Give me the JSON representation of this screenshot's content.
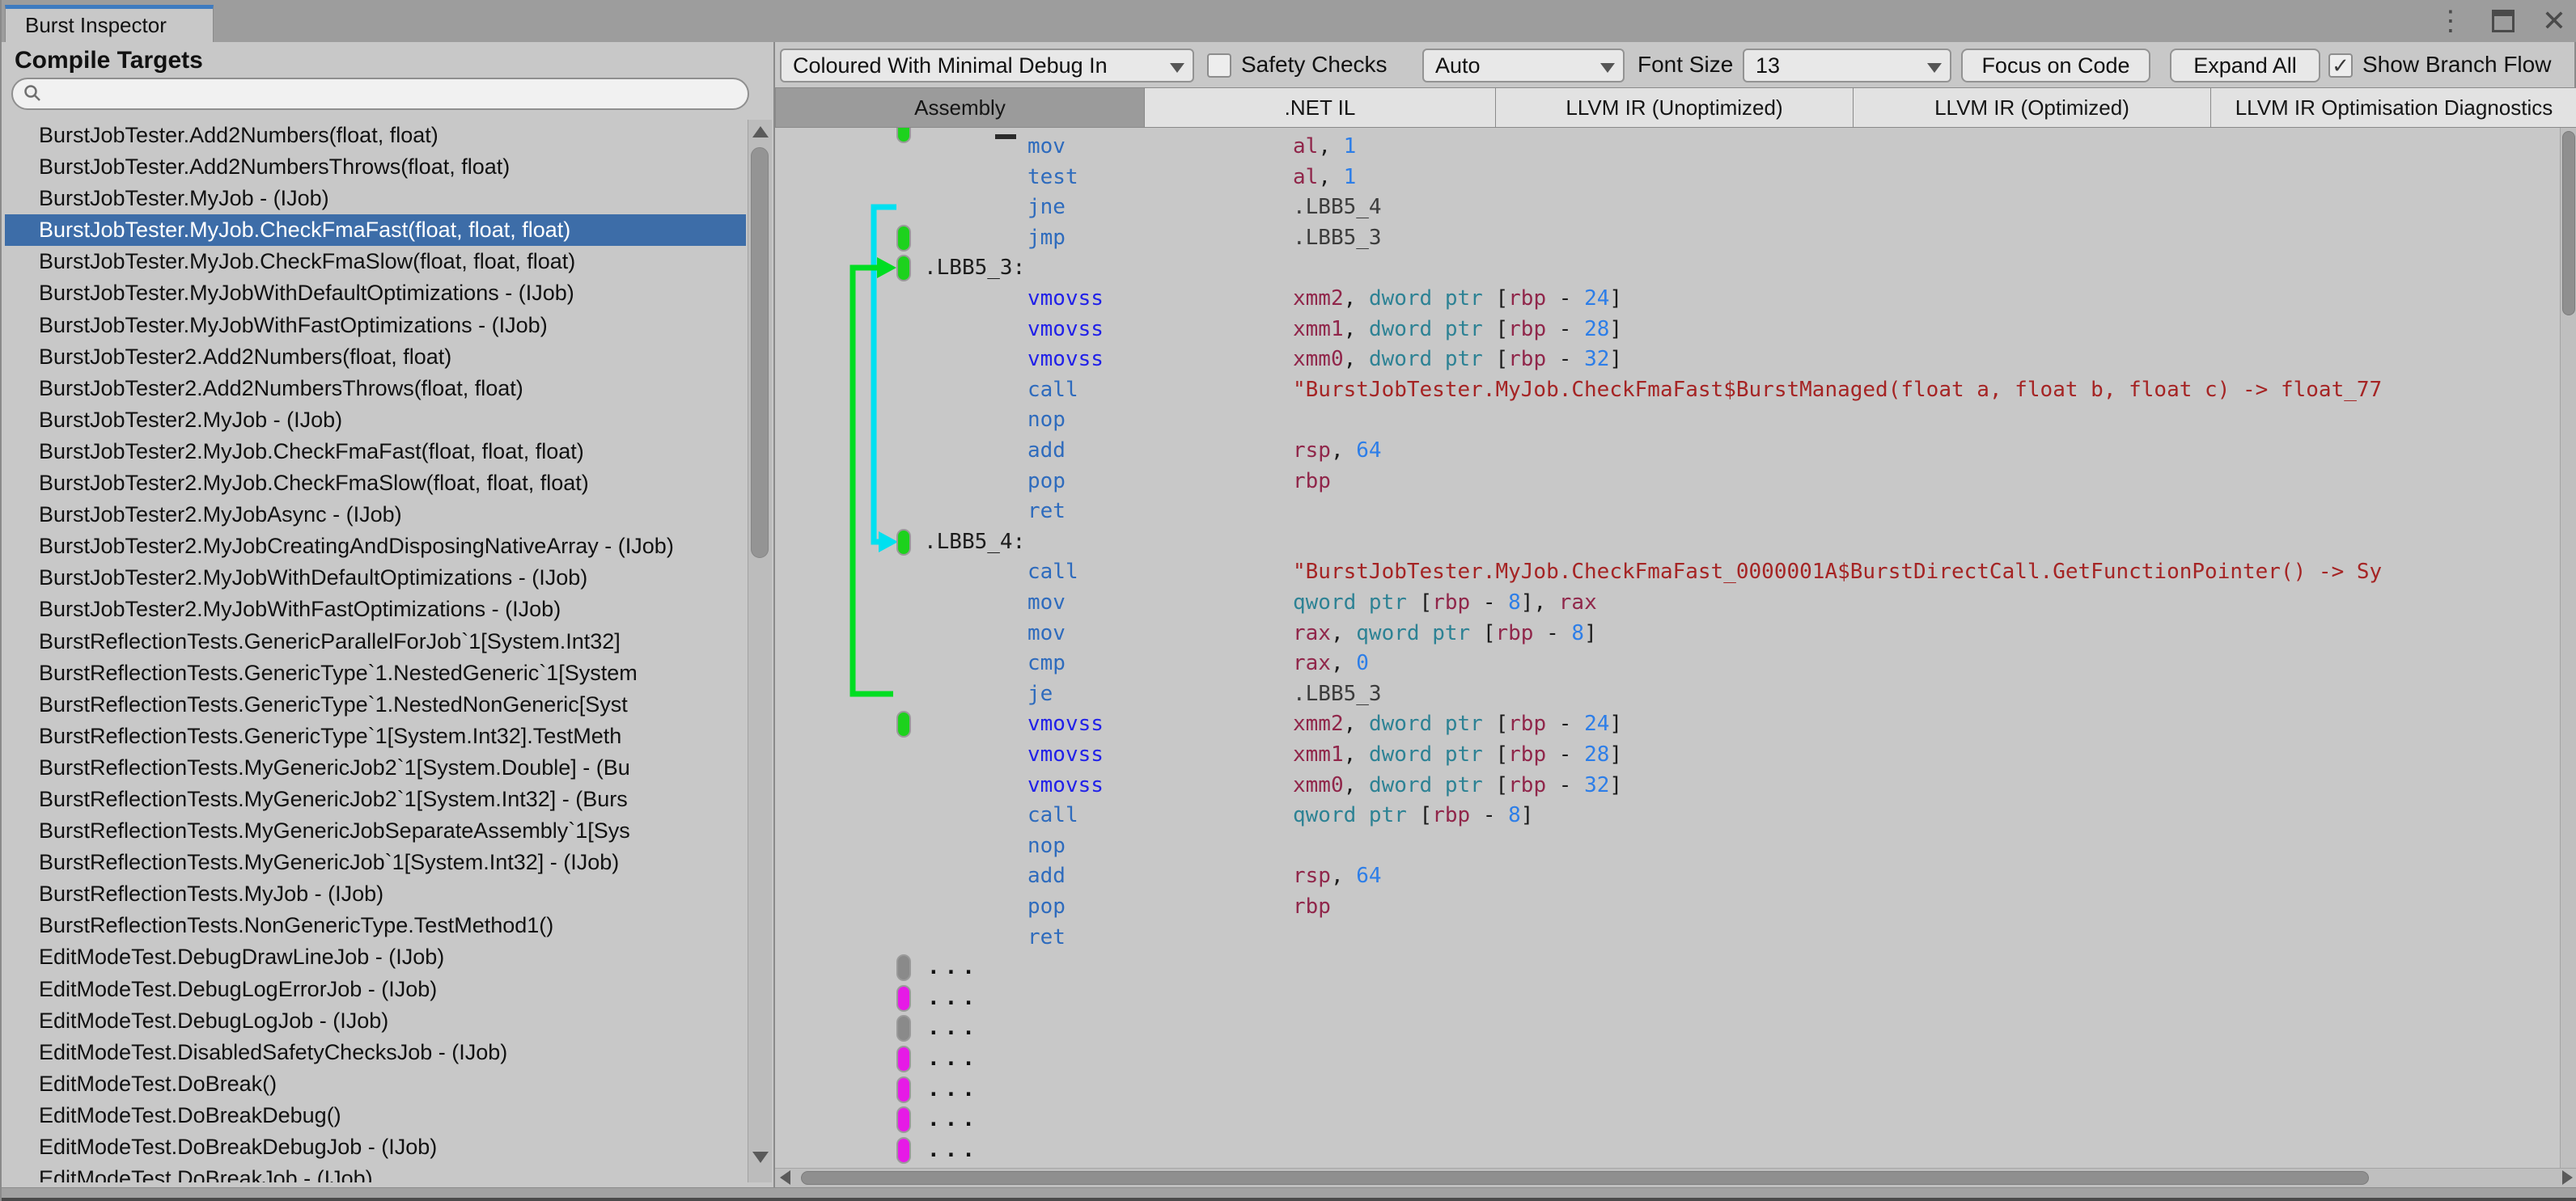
{
  "window": {
    "title_tab": "Burst Inspector",
    "controls": {
      "menu": "⋮",
      "close": "✕"
    }
  },
  "left_panel": {
    "header": "Compile Targets",
    "search_placeholder": "",
    "items": [
      {
        "label": "BurstJobTester.Add2Numbers(float, float)",
        "selected": false
      },
      {
        "label": "BurstJobTester.Add2NumbersThrows(float, float)",
        "selected": false
      },
      {
        "label": "BurstJobTester.MyJob - (IJob)",
        "selected": false
      },
      {
        "label": "BurstJobTester.MyJob.CheckFmaFast(float, float, float)",
        "selected": true
      },
      {
        "label": "BurstJobTester.MyJob.CheckFmaSlow(float, float, float)",
        "selected": false
      },
      {
        "label": "BurstJobTester.MyJobWithDefaultOptimizations - (IJob)",
        "selected": false
      },
      {
        "label": "BurstJobTester.MyJobWithFastOptimizations - (IJob)",
        "selected": false
      },
      {
        "label": "BurstJobTester2.Add2Numbers(float, float)",
        "selected": false
      },
      {
        "label": "BurstJobTester2.Add2NumbersThrows(float, float)",
        "selected": false
      },
      {
        "label": "BurstJobTester2.MyJob - (IJob)",
        "selected": false
      },
      {
        "label": "BurstJobTester2.MyJob.CheckFmaFast(float, float, float)",
        "selected": false
      },
      {
        "label": "BurstJobTester2.MyJob.CheckFmaSlow(float, float, float)",
        "selected": false
      },
      {
        "label": "BurstJobTester2.MyJobAsync - (IJob)",
        "selected": false
      },
      {
        "label": "BurstJobTester2.MyJobCreatingAndDisposingNativeArray - (IJob)",
        "selected": false
      },
      {
        "label": "BurstJobTester2.MyJobWithDefaultOptimizations - (IJob)",
        "selected": false
      },
      {
        "label": "BurstJobTester2.MyJobWithFastOptimizations - (IJob)",
        "selected": false
      },
      {
        "label": "BurstReflectionTests.GenericParallelForJob`1[System.Int32]",
        "selected": false
      },
      {
        "label": "BurstReflectionTests.GenericType`1.NestedGeneric`1[System",
        "selected": false
      },
      {
        "label": "BurstReflectionTests.GenericType`1.NestedNonGeneric[Syst",
        "selected": false
      },
      {
        "label": "BurstReflectionTests.GenericType`1[System.Int32].TestMeth",
        "selected": false
      },
      {
        "label": "BurstReflectionTests.MyGenericJob2`1[System.Double] - (Bu",
        "selected": false
      },
      {
        "label": "BurstReflectionTests.MyGenericJob2`1[System.Int32] - (Burs",
        "selected": false
      },
      {
        "label": "BurstReflectionTests.MyGenericJobSeparateAssembly`1[Sys",
        "selected": false
      },
      {
        "label": "BurstReflectionTests.MyGenericJob`1[System.Int32] - (IJob)",
        "selected": false
      },
      {
        "label": "BurstReflectionTests.MyJob - (IJob)",
        "selected": false
      },
      {
        "label": "BurstReflectionTests.NonGenericType.TestMethod1()",
        "selected": false
      },
      {
        "label": "EditModeTest.DebugDrawLineJob - (IJob)",
        "selected": false
      },
      {
        "label": "EditModeTest.DebugLogErrorJob - (IJob)",
        "selected": false
      },
      {
        "label": "EditModeTest.DebugLogJob - (IJob)",
        "selected": false
      },
      {
        "label": "EditModeTest.DisabledSafetyChecksJob - (IJob)",
        "selected": false
      },
      {
        "label": "EditModeTest.DoBreak()",
        "selected": false
      },
      {
        "label": "EditModeTest.DoBreakDebug()",
        "selected": false
      },
      {
        "label": "EditModeTest.DoBreakDebugJob - (IJob)",
        "selected": false
      },
      {
        "label": "EditModeTest.DoBreakJob - (IJob)",
        "selected": false
      }
    ]
  },
  "toolbar": {
    "display_mode": "Coloured With Minimal Debug In",
    "safety_checks_label": "Safety Checks",
    "safety_checks_checked": false,
    "target_dropdown": "Auto",
    "font_size_label": "Font Size",
    "font_size_value": "13",
    "focus_button": "Focus on Code",
    "expand_button": "Expand All",
    "branch_flow_label": "Show Branch Flow",
    "branch_flow_checked": true,
    "checkmark": "✓"
  },
  "tabs": [
    {
      "label": "Assembly",
      "active": true
    },
    {
      "label": ".NET IL",
      "active": false
    },
    {
      "label": "LLVM IR (Unoptimized)",
      "active": false
    },
    {
      "label": "LLVM IR (Optimized)",
      "active": false
    },
    {
      "label": "LLVM IR Optimisation Diagnostics",
      "active": false
    }
  ],
  "code": {
    "lines": [
      {
        "kind": "ins",
        "mn": "mov",
        "mnc": "t-mn",
        "ops": [
          [
            "t-reg",
            "al"
          ],
          [
            "t-pu",
            ", "
          ],
          [
            "t-num",
            "1"
          ]
        ]
      },
      {
        "kind": "ins",
        "mn": "test",
        "mnc": "t-mn",
        "ops": [
          [
            "t-reg",
            "al"
          ],
          [
            "t-pu",
            ", "
          ],
          [
            "t-num",
            "1"
          ]
        ]
      },
      {
        "kind": "ins",
        "mn": "jne",
        "mnc": "t-mn",
        "ops": [
          [
            "t-lbl",
            ".LBB5_4"
          ]
        ]
      },
      {
        "kind": "ins",
        "mn": "jmp",
        "mnc": "t-mn",
        "ops": [
          [
            "t-lbl",
            ".LBB5_3"
          ]
        ],
        "pill": "p-green"
      },
      {
        "kind": "label",
        "label": ".LBB5_3:",
        "pill": "p-green"
      },
      {
        "kind": "ins",
        "mn": "vmovss",
        "mnc": "t-simd",
        "ops": [
          [
            "t-reg",
            "xmm2"
          ],
          [
            "t-pu",
            ", "
          ],
          [
            "t-kw",
            "dword ptr"
          ],
          [
            "t-pu",
            " ["
          ],
          [
            "t-reg",
            "rbp"
          ],
          [
            "t-pu",
            " - "
          ],
          [
            "t-num",
            "24"
          ],
          [
            "t-pu",
            "]"
          ]
        ]
      },
      {
        "kind": "ins",
        "mn": "vmovss",
        "mnc": "t-simd",
        "ops": [
          [
            "t-reg",
            "xmm1"
          ],
          [
            "t-pu",
            ", "
          ],
          [
            "t-kw",
            "dword ptr"
          ],
          [
            "t-pu",
            " ["
          ],
          [
            "t-reg",
            "rbp"
          ],
          [
            "t-pu",
            " - "
          ],
          [
            "t-num",
            "28"
          ],
          [
            "t-pu",
            "]"
          ]
        ]
      },
      {
        "kind": "ins",
        "mn": "vmovss",
        "mnc": "t-simd",
        "ops": [
          [
            "t-reg",
            "xmm0"
          ],
          [
            "t-pu",
            ", "
          ],
          [
            "t-kw",
            "dword ptr"
          ],
          [
            "t-pu",
            " ["
          ],
          [
            "t-reg",
            "rbp"
          ],
          [
            "t-pu",
            " - "
          ],
          [
            "t-num",
            "32"
          ],
          [
            "t-pu",
            "]"
          ]
        ]
      },
      {
        "kind": "ins",
        "mn": "call",
        "mnc": "t-mn",
        "ops": [
          [
            "t-str",
            "\"BurstJobTester.MyJob.CheckFmaFast$BurstManaged(float a, float b, float c) -> float_77"
          ]
        ]
      },
      {
        "kind": "ins",
        "mn": "nop",
        "mnc": "t-mn",
        "ops": []
      },
      {
        "kind": "ins",
        "mn": "add",
        "mnc": "t-mn",
        "ops": [
          [
            "t-reg",
            "rsp"
          ],
          [
            "t-pu",
            ", "
          ],
          [
            "t-num",
            "64"
          ]
        ]
      },
      {
        "kind": "ins",
        "mn": "pop",
        "mnc": "t-mn",
        "ops": [
          [
            "t-reg",
            "rbp"
          ]
        ]
      },
      {
        "kind": "ins",
        "mn": "ret",
        "mnc": "t-mn",
        "ops": []
      },
      {
        "kind": "label",
        "label": ".LBB5_4:",
        "pill": "p-green"
      },
      {
        "kind": "ins",
        "mn": "call",
        "mnc": "t-mn",
        "ops": [
          [
            "t-str",
            "\"BurstJobTester.MyJob.CheckFmaFast_0000001A$BurstDirectCall.GetFunctionPointer() -> Sy"
          ]
        ]
      },
      {
        "kind": "ins",
        "mn": "mov",
        "mnc": "t-mn",
        "ops": [
          [
            "t-kw",
            "qword ptr"
          ],
          [
            "t-pu",
            " ["
          ],
          [
            "t-reg",
            "rbp"
          ],
          [
            "t-pu",
            " - "
          ],
          [
            "t-num",
            "8"
          ],
          [
            "t-pu",
            "], "
          ],
          [
            "t-reg",
            "rax"
          ]
        ]
      },
      {
        "kind": "ins",
        "mn": "mov",
        "mnc": "t-mn",
        "ops": [
          [
            "t-reg",
            "rax"
          ],
          [
            "t-pu",
            ", "
          ],
          [
            "t-kw",
            "qword ptr"
          ],
          [
            "t-pu",
            " ["
          ],
          [
            "t-reg",
            "rbp"
          ],
          [
            "t-pu",
            " - "
          ],
          [
            "t-num",
            "8"
          ],
          [
            "t-pu",
            "]"
          ]
        ]
      },
      {
        "kind": "ins",
        "mn": "cmp",
        "mnc": "t-mn",
        "ops": [
          [
            "t-reg",
            "rax"
          ],
          [
            "t-pu",
            ", "
          ],
          [
            "t-num",
            "0"
          ]
        ]
      },
      {
        "kind": "ins",
        "mn": "je",
        "mnc": "t-mn",
        "ops": [
          [
            "t-lbl",
            ".LBB5_3"
          ]
        ]
      },
      {
        "kind": "ins",
        "mn": "vmovss",
        "mnc": "t-simd",
        "ops": [
          [
            "t-reg",
            "xmm2"
          ],
          [
            "t-pu",
            ", "
          ],
          [
            "t-kw",
            "dword ptr"
          ],
          [
            "t-pu",
            " ["
          ],
          [
            "t-reg",
            "rbp"
          ],
          [
            "t-pu",
            " - "
          ],
          [
            "t-num",
            "24"
          ],
          [
            "t-pu",
            "]"
          ]
        ],
        "pill": "p-green"
      },
      {
        "kind": "ins",
        "mn": "vmovss",
        "mnc": "t-simd",
        "ops": [
          [
            "t-reg",
            "xmm1"
          ],
          [
            "t-pu",
            ", "
          ],
          [
            "t-kw",
            "dword ptr"
          ],
          [
            "t-pu",
            " ["
          ],
          [
            "t-reg",
            "rbp"
          ],
          [
            "t-pu",
            " - "
          ],
          [
            "t-num",
            "28"
          ],
          [
            "t-pu",
            "]"
          ]
        ]
      },
      {
        "kind": "ins",
        "mn": "vmovss",
        "mnc": "t-simd",
        "ops": [
          [
            "t-reg",
            "xmm0"
          ],
          [
            "t-pu",
            ", "
          ],
          [
            "t-kw",
            "dword ptr"
          ],
          [
            "t-pu",
            " ["
          ],
          [
            "t-reg",
            "rbp"
          ],
          [
            "t-pu",
            " - "
          ],
          [
            "t-num",
            "32"
          ],
          [
            "t-pu",
            "]"
          ]
        ]
      },
      {
        "kind": "ins",
        "mn": "call",
        "mnc": "t-mn",
        "ops": [
          [
            "t-kw",
            "qword ptr"
          ],
          [
            "t-pu",
            " ["
          ],
          [
            "t-reg",
            "rbp"
          ],
          [
            "t-pu",
            " - "
          ],
          [
            "t-num",
            "8"
          ],
          [
            "t-pu",
            "]"
          ]
        ]
      },
      {
        "kind": "ins",
        "mn": "nop",
        "mnc": "t-mn",
        "ops": []
      },
      {
        "kind": "ins",
        "mn": "add",
        "mnc": "t-mn",
        "ops": [
          [
            "t-reg",
            "rsp"
          ],
          [
            "t-pu",
            ", "
          ],
          [
            "t-num",
            "64"
          ]
        ]
      },
      {
        "kind": "ins",
        "mn": "pop",
        "mnc": "t-mn",
        "ops": [
          [
            "t-reg",
            "rbp"
          ]
        ]
      },
      {
        "kind": "ins",
        "mn": "ret",
        "mnc": "t-mn",
        "ops": []
      },
      {
        "kind": "dots",
        "text": "...",
        "pill": "p-gray"
      },
      {
        "kind": "dots",
        "text": "...",
        "pill": "p-magenta"
      },
      {
        "kind": "dots",
        "text": "...",
        "pill": "p-gray"
      },
      {
        "kind": "dots",
        "text": "...",
        "pill": "p-magenta"
      },
      {
        "kind": "dots",
        "text": "...",
        "pill": "p-magenta"
      },
      {
        "kind": "dots",
        "text": "...",
        "pill": "p-magenta"
      },
      {
        "kind": "dots",
        "text": "...",
        "pill": "p-magenta"
      }
    ]
  },
  "colors": {
    "selection_blue": "#3d6da8",
    "tab_accent_blue": "#3e7bc0",
    "branch_cyan": "#00e0f0",
    "branch_green": "#00dd22",
    "block_green": "#1dd21d",
    "block_magenta": "#e61ae6",
    "block_gray": "#8a8a8a"
  }
}
